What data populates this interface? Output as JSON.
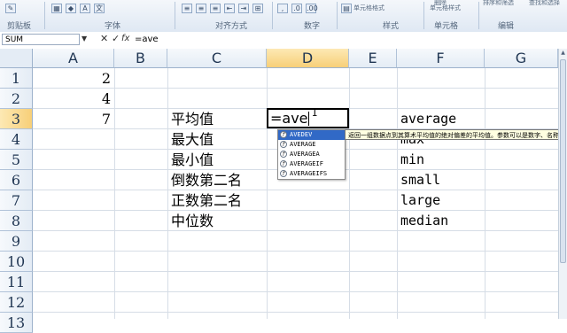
{
  "ribbon": {
    "groups": [
      "剪贴板",
      "字体",
      "对齐方式",
      "数字",
      "样式",
      "单元格",
      "编辑"
    ],
    "format_cells": "单元格格式",
    "cell_style": "单元格样式",
    "delete": "删除",
    "sort_filter": "排序和筛选",
    "find_select": "查找和选择"
  },
  "formula_bar": {
    "name_box": "SUM",
    "cancel_glyph": "✕",
    "enter_glyph": "✓",
    "fx_label": "fx",
    "formula": "=ave"
  },
  "columns": [
    "A",
    "B",
    "C",
    "D",
    "E",
    "F",
    "G"
  ],
  "rows": [
    "1",
    "2",
    "3",
    "4",
    "5",
    "6",
    "7",
    "8",
    "9",
    "10",
    "11",
    "12",
    "13"
  ],
  "cells": {
    "A1": "2",
    "A2": "4",
    "A3": "7",
    "C3": "平均值",
    "C4": "最大值",
    "C5": "最小值",
    "C6": "倒数第二名",
    "C7": "正数第二名",
    "C8": "中位数",
    "D3": "=ave",
    "F3": "average",
    "F4": "max",
    "F5": "min",
    "F6": "small",
    "F7": "large",
    "F8": "median"
  },
  "autocomplete": {
    "items": [
      "AVEDEV",
      "AVERAGE",
      "AVERAGEA",
      "AVERAGEIF",
      "AVERAGEIFS"
    ],
    "selected_index": 0,
    "tooltip": "返回一组数据点到其算术平均值的绝对偏差的平均值。参数可以是数字、名称"
  },
  "colors": {
    "selection": "#3169c6",
    "header_active": "#f7cf78"
  }
}
